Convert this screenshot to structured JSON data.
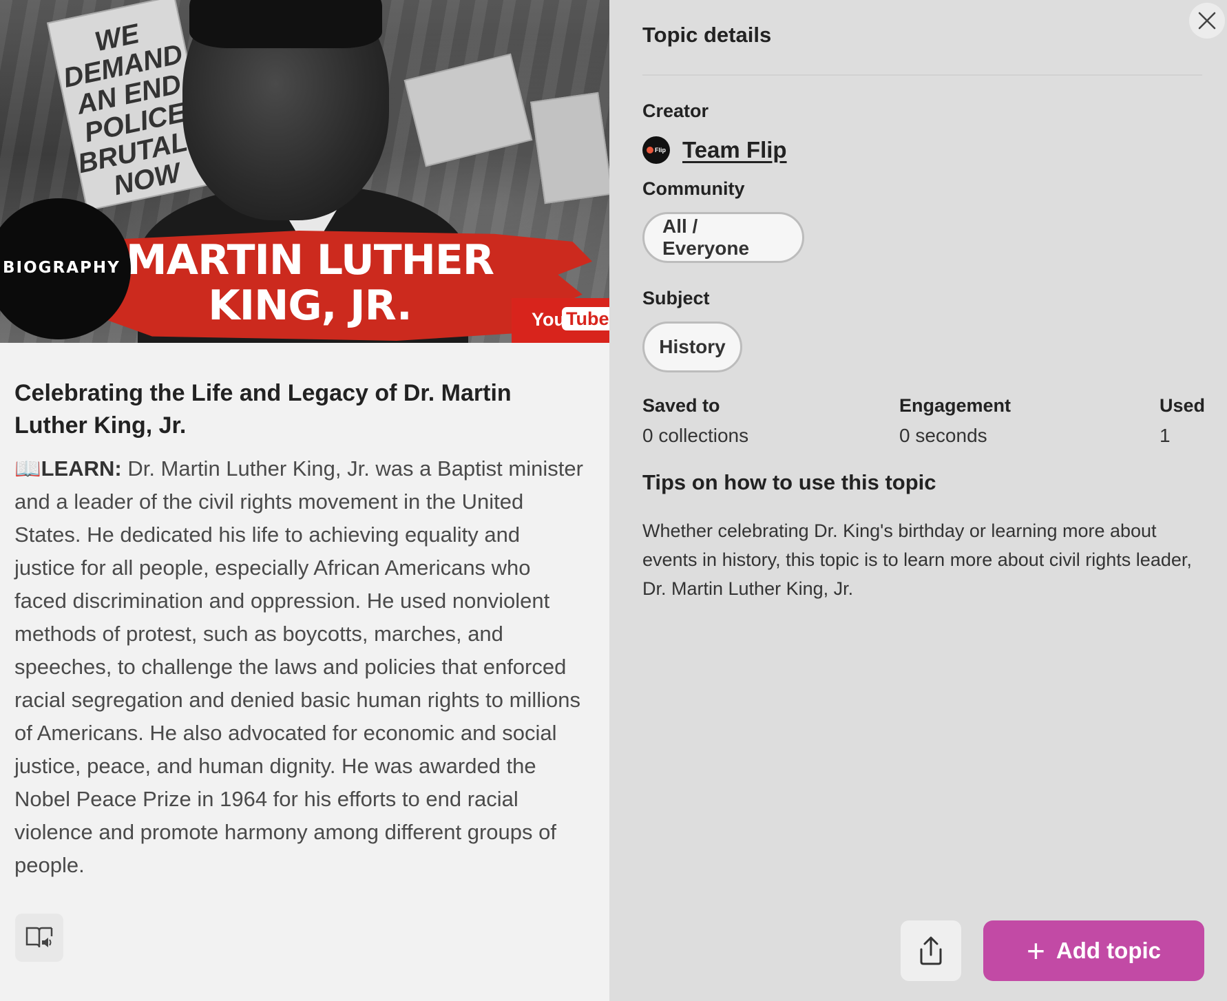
{
  "thumbnail": {
    "brand": "BIOGRAPHY",
    "title_line1": "MARTIN LUTHER",
    "title_line2": "KING, JR.",
    "sign1_text": "WE DEMAND AN END POLICE BRUTALITY NOW",
    "yt_you": "You",
    "yt_tube": "Tube"
  },
  "topic": {
    "title": "Celebrating the Life and Legacy of Dr. Martin Luther King, Jr.",
    "learn_emoji": "📖",
    "learn_label": "LEARN:",
    "description": " Dr. Martin Luther King, Jr. was a Baptist minister and a leader of the civil rights movement in the United States. He dedicated his life to achieving equality and justice for all people, especially African Americans who faced discrimination and oppression. He used nonviolent methods of protest, such as boycotts, marches, and speeches, to challenge the laws and policies that enforced racial segregation and denied basic human rights to millions of Americans. He also advocated for economic and social justice, peace, and human dignity. He was awarded the Nobel Peace Prize in 1964 for his efforts to end racial violence and promote harmony among different groups of people."
  },
  "details": {
    "heading": "Topic details",
    "creator_label": "Creator",
    "creator_name": "Team Flip",
    "creator_logo_text": "Flip",
    "community_label": "Community",
    "community_value": "All / Everyone",
    "subject_label": "Subject",
    "subject_value": "History",
    "saved_label": "Saved to",
    "saved_value": "0 collections",
    "engagement_label": "Engagement",
    "engagement_value": "0 seconds",
    "used_label": "Used",
    "used_value": "1",
    "tips_heading": "Tips on how to use this topic",
    "tips_body": "Whether celebrating Dr. King's birthday or learning more about events in history, this topic is to learn more about civil rights leader, Dr. Martin Luther King, Jr."
  },
  "actions": {
    "add_topic_label": "Add topic",
    "add_icon": "+"
  },
  "colors": {
    "accent": "#c24aa5",
    "banner_red": "#cc2a1e",
    "youtube_red": "#d8241c"
  },
  "icons": {
    "close": "close-icon",
    "share": "share-icon",
    "immersive_reader": "immersive-reader-icon",
    "plus": "plus-icon"
  }
}
